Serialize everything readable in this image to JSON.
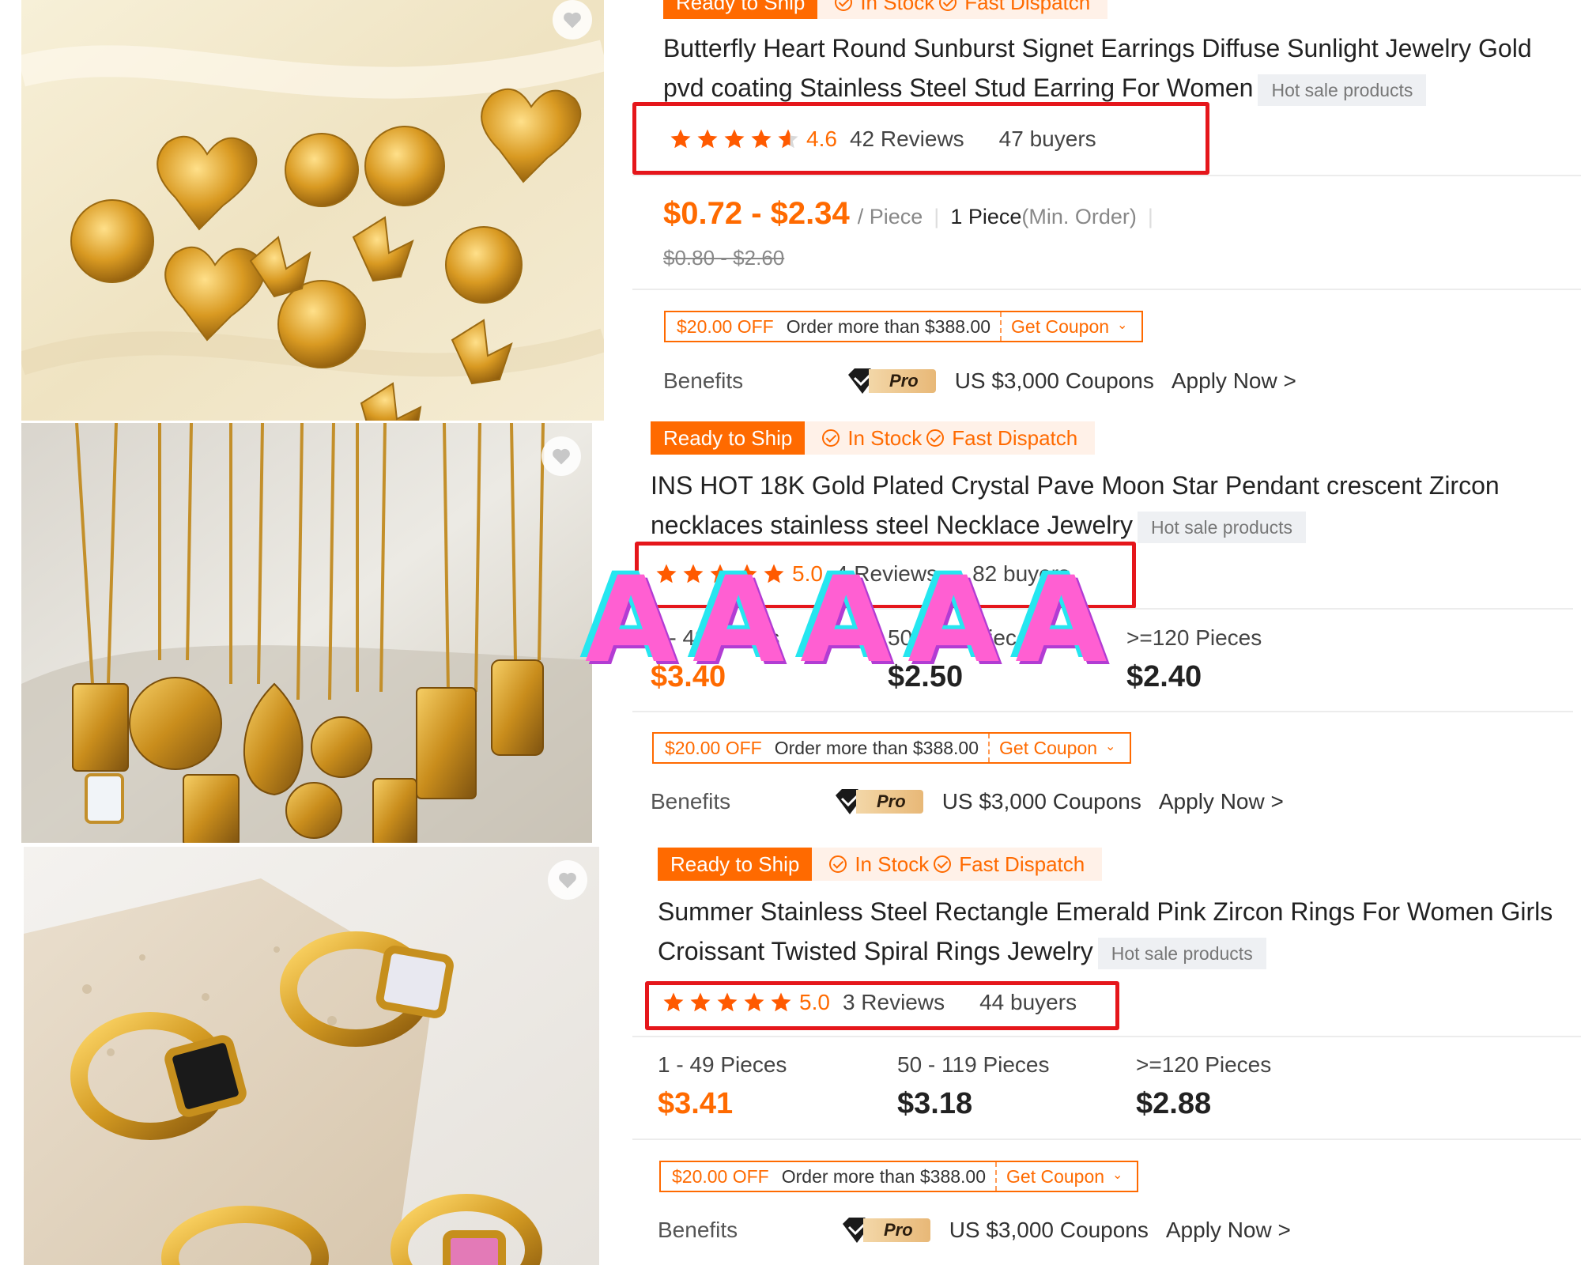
{
  "listings": [
    {
      "badges": {
        "ready": "Ready to Ship",
        "in_stock": "In Stock",
        "fast": "Fast Dispatch"
      },
      "title": "Butterfly Heart Round Sunburst Signet Earrings Diffuse Sunlight Jewelry Gold pvd coating Stainless Steel Stud Earring For Women",
      "hot_tag": "Hot sale products",
      "rating": {
        "score": "4.6",
        "stars": 4.6,
        "reviews": "42 Reviews",
        "buyers": "47 buyers"
      },
      "price": {
        "range": "$0.72 - $2.34",
        "unit": "/ Piece",
        "min_qty": "1 Piece",
        "min_label": "(Min. Order)",
        "original": "$0.80 - $2.60"
      },
      "coupon": {
        "off": "$20.00 OFF",
        "condition": "Order more than $388.00",
        "action": "Get Coupon"
      },
      "benefits": {
        "label": "Benefits",
        "pro": "Pro",
        "coupons": "US $3,000 Coupons",
        "apply": "Apply Now >"
      }
    },
    {
      "badges": {
        "ready": "Ready to Ship",
        "in_stock": "In Stock",
        "fast": "Fast Dispatch"
      },
      "title": "INS HOT 18K Gold Plated Crystal Pave Moon Star Pendant crescent Zircon necklaces stainless steel Necklace Jewelry",
      "hot_tag": "Hot sale products",
      "rating": {
        "score": "5.0",
        "stars": 5,
        "reviews": "4 Reviews",
        "buyers": "82 buyers"
      },
      "tiers": [
        {
          "qty": "1 - 49 Pieces",
          "price": "$3.40"
        },
        {
          "qty": "50 - 119 Pieces",
          "price": "$2.50"
        },
        {
          "qty": ">=120 Pieces",
          "price": "$2.40"
        }
      ],
      "coupon": {
        "off": "$20.00 OFF",
        "condition": "Order more than $388.00",
        "action": "Get Coupon"
      },
      "benefits": {
        "label": "Benefits",
        "pro": "Pro",
        "coupons": "US $3,000 Coupons",
        "apply": "Apply Now >"
      }
    },
    {
      "badges": {
        "ready": "Ready to Ship",
        "in_stock": "In Stock",
        "fast": "Fast Dispatch"
      },
      "title": "Summer Stainless Steel Rectangle Emerald Pink Zircon Rings For Women Girls Croissant Twisted Spiral Rings Jewelry",
      "hot_tag": "Hot sale products",
      "rating": {
        "score": "5.0",
        "stars": 5,
        "reviews": "3 Reviews",
        "buyers": "44 buyers"
      },
      "tiers": [
        {
          "qty": "1 - 49 Pieces",
          "price": "$3.41"
        },
        {
          "qty": "50 - 119 Pieces",
          "price": "$3.18"
        },
        {
          "qty": ">=120 Pieces",
          "price": "$2.88"
        }
      ],
      "coupon": {
        "off": "$20.00 OFF",
        "condition": "Order more than $388.00",
        "action": "Get Coupon"
      },
      "benefits": {
        "label": "Benefits",
        "pro": "Pro",
        "coupons": "US $3,000 Coupons",
        "apply": "Apply Now >"
      }
    }
  ],
  "overlay_text": "AAAAA",
  "colors": {
    "accent": "#ff6a00",
    "highlight_box": "#e5161b"
  }
}
